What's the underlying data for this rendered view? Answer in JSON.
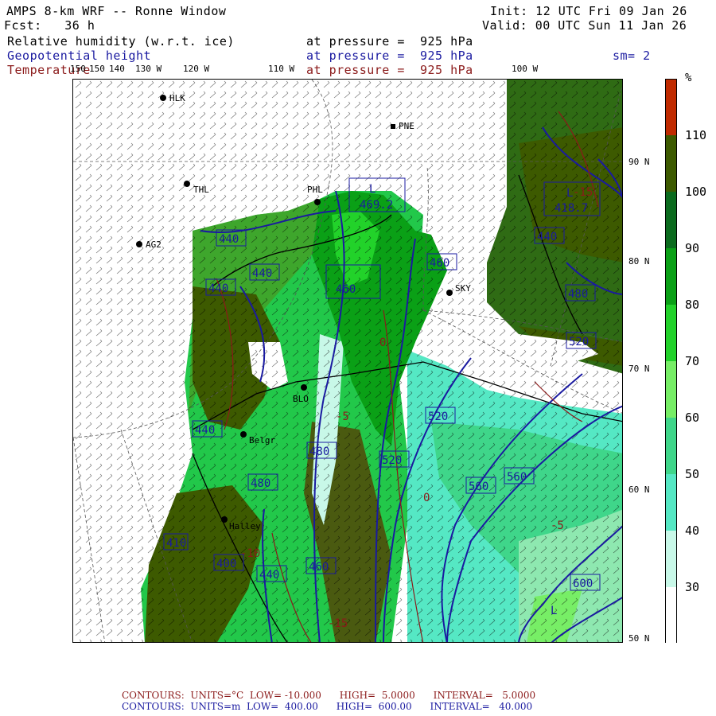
{
  "header": {
    "title": "AMPS 8-km WRF -- Ronne Window",
    "fcst": "Fcst:   36 h",
    "init": "Init: 12 UTC Fri 09 Jan 26",
    "valid": "Valid: 00 UTC Sun 11 Jan 26",
    "fields": [
      {
        "name": "Relative humidity (w.r.t. ice)",
        "level": "at pressure =  925 hPa"
      },
      {
        "name": "Geopotential height",
        "level": "at pressure =  925 hPa"
      },
      {
        "name": "Temperature",
        "level": "at pressure =  925 hPa"
      }
    ],
    "smoothing": "sm= 2"
  },
  "longitude_labels": [
    "150",
    "150",
    "140",
    "130 W",
    "120 W",
    "110 W",
    "100 W"
  ],
  "latitude_labels": [
    "90 N",
    "80 N",
    "70 N",
    "60 N",
    "50 N"
  ],
  "stations": [
    "HLK",
    "PNE",
    "THL",
    "PHL",
    "AG2",
    "SKY",
    "BLO",
    "Belgr",
    "Halley"
  ],
  "pressure_centers": [
    {
      "type": "L",
      "value": "469.2"
    },
    {
      "type": "L",
      "value": "418.7"
    },
    {
      "type": "L",
      "value": ""
    }
  ],
  "height_contour_labels": [
    "440",
    "440",
    "440",
    "440",
    "440",
    "440",
    "460",
    "460",
    "460",
    "480",
    "480",
    "480",
    "480",
    "400",
    "410",
    "520",
    "520",
    "520",
    "560",
    "560",
    "600"
  ],
  "temp_contour_labels": [
    "0",
    "0",
    "-5",
    "-5",
    "-10",
    "-15",
    "-15"
  ],
  "colorbar": {
    "unit": "%",
    "ticks": [
      "110",
      "100",
      "90",
      "80",
      "70",
      "60",
      "50",
      "40",
      "30"
    ],
    "colors": [
      "#c02a00",
      "#3d5a00",
      "#0b6b1e",
      "#0aa016",
      "#22d22a",
      "#77ee66",
      "#3fd68a",
      "#55e8c4",
      "#c8f8e8",
      "#ffffff"
    ]
  },
  "footer": {
    "line1": "CONTOURS:  UNITS=°C  LOW= -10.000      HIGH=  5.0000      INTERVAL=   5.0000",
    "line2": "CONTOURS:  UNITS=m  LOW=  400.00      HIGH=  600.00      INTERVAL=   40.000"
  },
  "colors": {
    "height_contour": "#1a1aa0",
    "temp_contour": "#8b1a1a",
    "title_text": "#000000"
  }
}
